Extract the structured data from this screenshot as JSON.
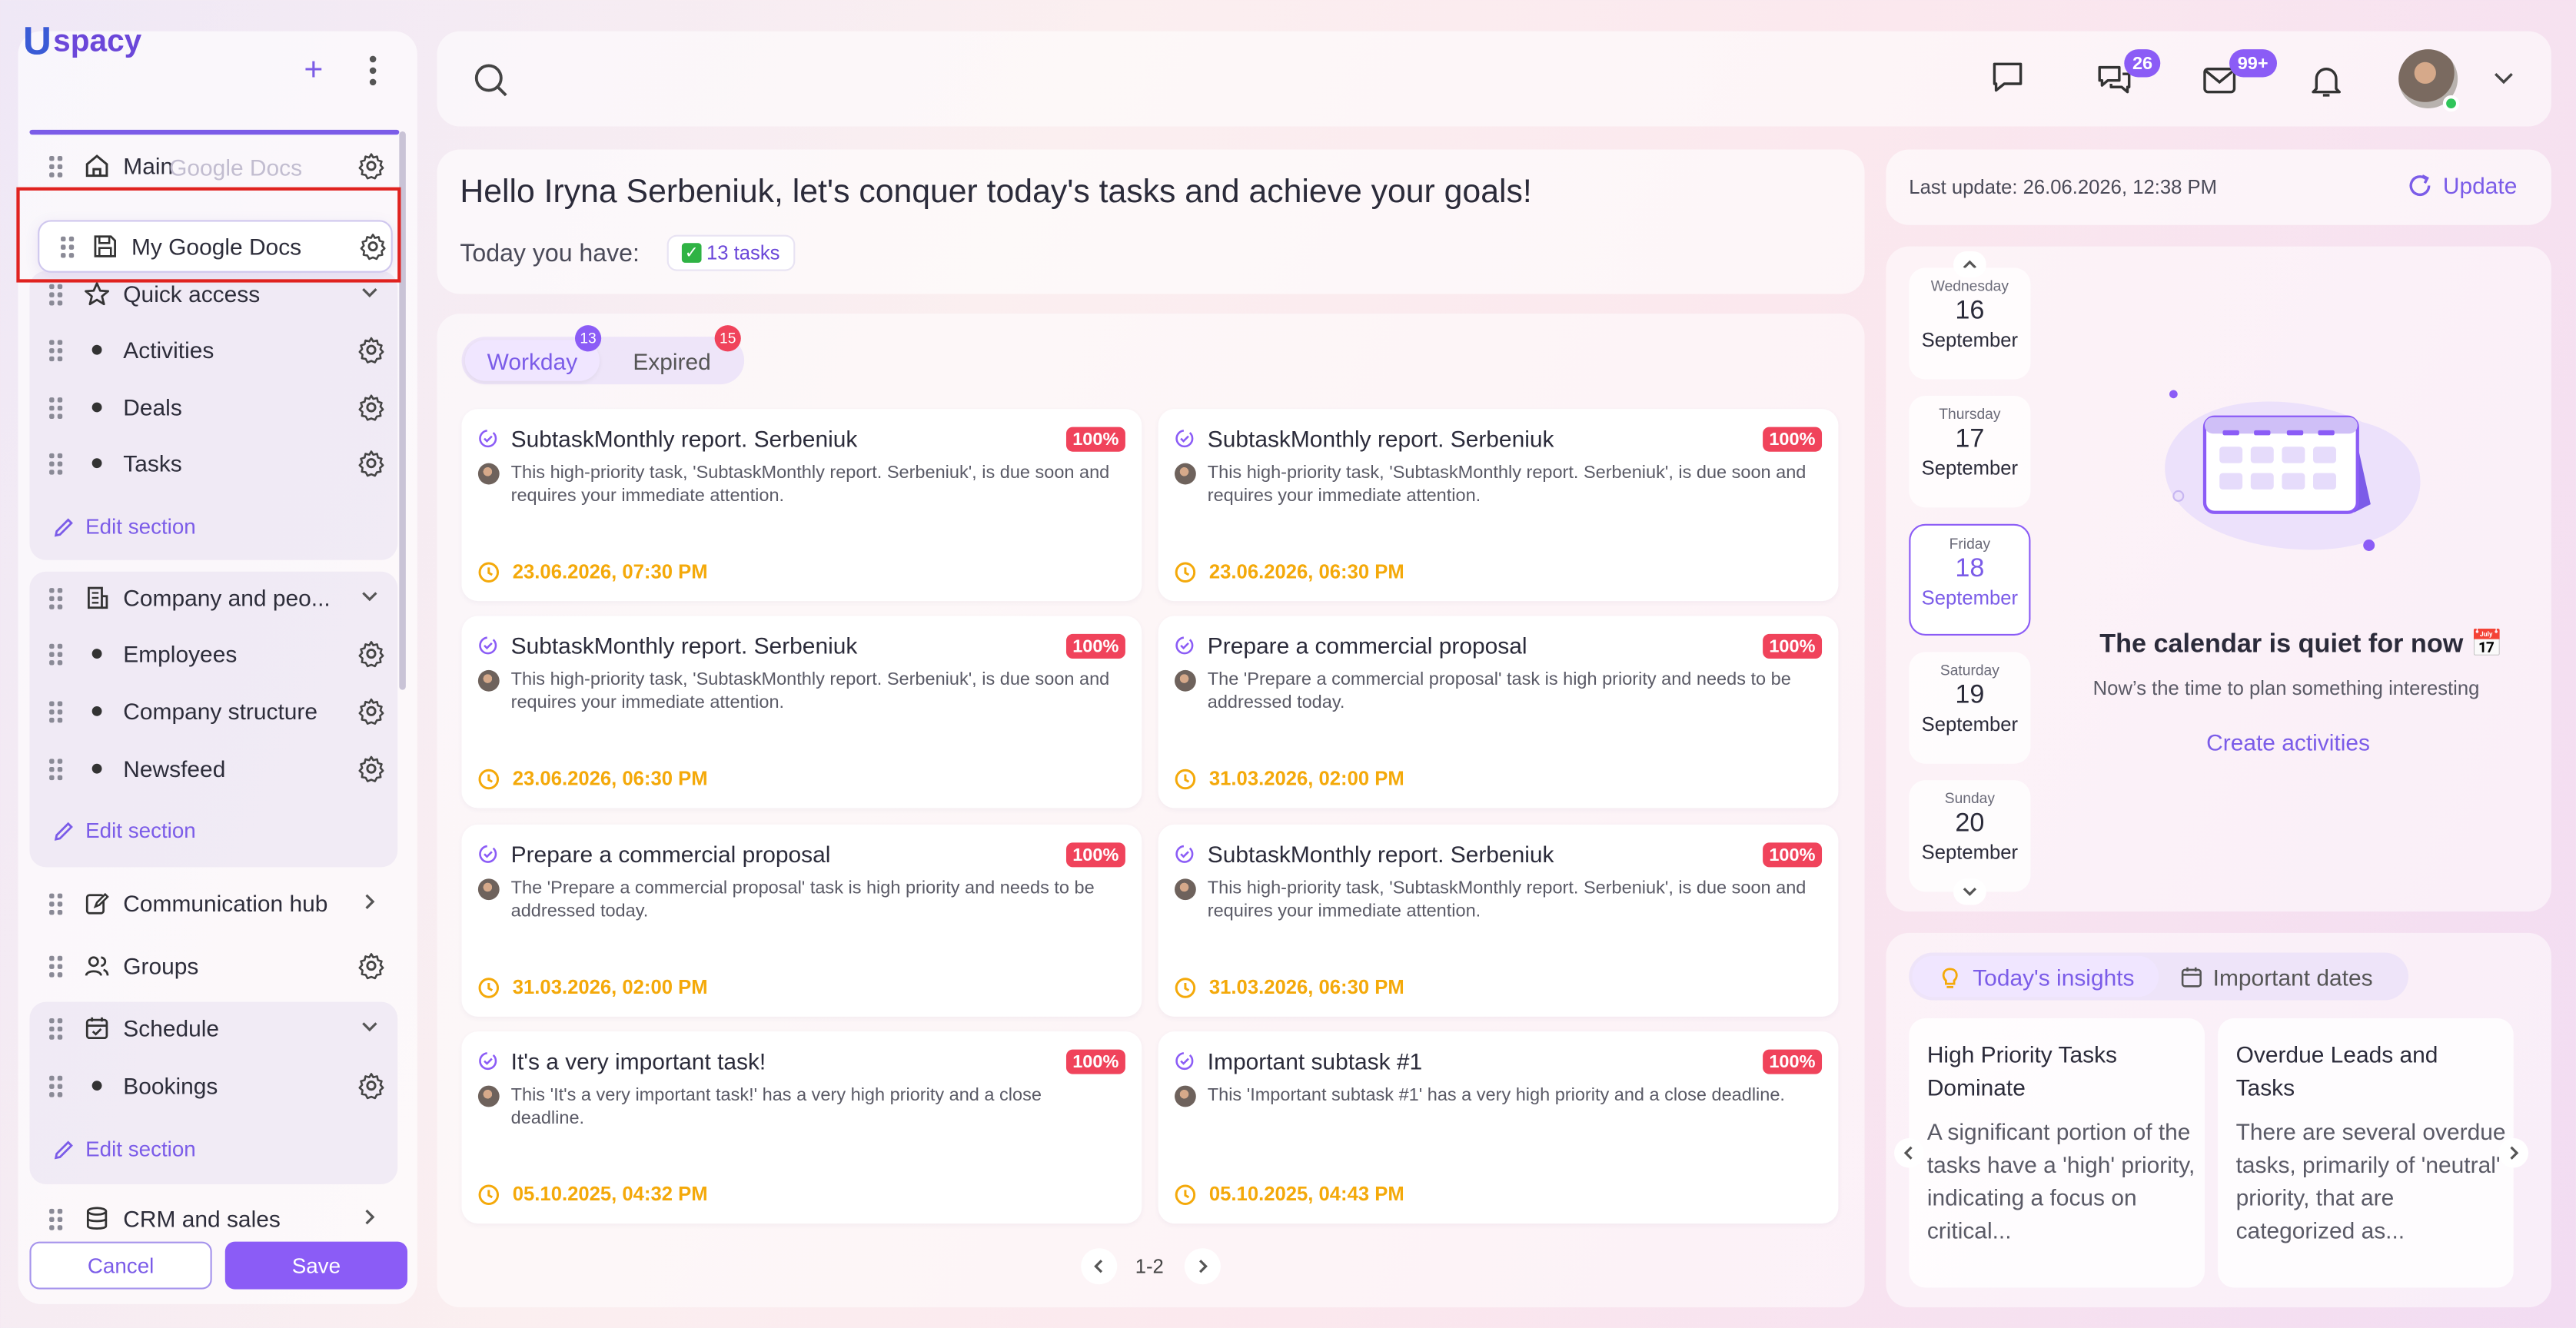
{
  "sidebar": {
    "logo_mark": "U",
    "logo_text": "spacy",
    "plus": "+",
    "ghost_label": "Google Docs",
    "dragging_label": "My Google Docs",
    "items": [
      {
        "label": "Main"
      },
      {
        "label": "Quick access"
      },
      {
        "label": "Activities"
      },
      {
        "label": "Deals"
      },
      {
        "label": "Tasks"
      },
      {
        "label": "Company and peo..."
      },
      {
        "label": "Employees"
      },
      {
        "label": "Company structure"
      },
      {
        "label": "Newsfeed"
      },
      {
        "label": "Communication hub"
      },
      {
        "label": "Groups"
      },
      {
        "label": "Schedule"
      },
      {
        "label": "Bookings"
      },
      {
        "label": "CRM and sales"
      }
    ],
    "edit_section": "Edit section",
    "cancel": "Cancel",
    "save": "Save"
  },
  "header": {
    "chat_badge": "26",
    "mail_badge": "99+"
  },
  "greeting": {
    "title": "Hello Iryna Serbeniuk, let's conquer today's tasks and achieve your goals!",
    "today_label": "Today you have:",
    "tasks_chip": "13 tasks"
  },
  "tabs": {
    "workday": "Workday",
    "workday_count": "13",
    "expired": "Expired",
    "expired_count": "15"
  },
  "tasks": [
    {
      "title": "SubtaskMonthly report. Serbeniuk",
      "pct": "100%",
      "desc": "This high-priority task, 'SubtaskMonthly report. Serbeniuk', is due soon and requires your immediate attention.",
      "date": "23.06.2026, 07:30 PM"
    },
    {
      "title": "SubtaskMonthly report. Serbeniuk",
      "pct": "100%",
      "desc": "This high-priority task, 'SubtaskMonthly report. Serbeniuk', is due soon and requires your immediate attention.",
      "date": "23.06.2026, 06:30 PM"
    },
    {
      "title": "SubtaskMonthly report. Serbeniuk",
      "pct": "100%",
      "desc": "This high-priority task, 'SubtaskMonthly report. Serbeniuk', is due soon and requires your immediate attention.",
      "date": "23.06.2026, 06:30 PM"
    },
    {
      "title": "Prepare a commercial proposal",
      "pct": "100%",
      "desc": "The 'Prepare a commercial proposal' task is high priority and needs to be addressed today.",
      "date": "31.03.2026, 02:00 PM"
    },
    {
      "title": "Prepare a commercial proposal",
      "pct": "100%",
      "desc": "The 'Prepare a commercial proposal' task is high priority and needs to be addressed today.",
      "date": "31.03.2026, 02:00 PM"
    },
    {
      "title": "SubtaskMonthly report. Serbeniuk",
      "pct": "100%",
      "desc": "This high-priority task, 'SubtaskMonthly report. Serbeniuk', is due soon and requires your immediate attention.",
      "date": "31.03.2026, 06:30 PM"
    },
    {
      "title": "It's a very important task!",
      "pct": "100%",
      "desc": "This 'It's a very important task!' has a very high priority and a close deadline.",
      "date": "05.10.2025, 04:32 PM"
    },
    {
      "title": "Important subtask #1",
      "pct": "100%",
      "desc": "This 'Important subtask #1' has a very high priority and a close deadline.",
      "date": "05.10.2025, 04:43 PM"
    }
  ],
  "pager": {
    "label": "1-2"
  },
  "update": {
    "text": "Last update: 26.06.2026, 12:38 PM",
    "button": "Update"
  },
  "calendar": {
    "days": [
      {
        "name": "Wednesday",
        "day": "16",
        "month": "September"
      },
      {
        "name": "Thursday",
        "day": "17",
        "month": "September"
      },
      {
        "name": "Friday",
        "day": "18",
        "month": "September"
      },
      {
        "name": "Saturday",
        "day": "19",
        "month": "September"
      },
      {
        "name": "Sunday",
        "day": "20",
        "month": "September"
      }
    ],
    "quiet_title": "The calendar is quiet for now 📅",
    "quiet_sub": "Now’s the time to plan something interesting",
    "create": "Create activities"
  },
  "insights": {
    "tab_insights": "Today's insights",
    "tab_dates": "Important dates",
    "cards": [
      {
        "title": "High Priority Tasks Dominate",
        "body": "A significant portion of the tasks have a 'high' priority, indicating a focus on critical..."
      },
      {
        "title": "Overdue Leads and Tasks",
        "body": "There are several overdue tasks, primarily of 'neutral' priority, that are categorized as..."
      }
    ]
  },
  "colors": {
    "accent": "#8b5cf6",
    "danger": "#f0435b",
    "warning": "#f4a90a"
  }
}
